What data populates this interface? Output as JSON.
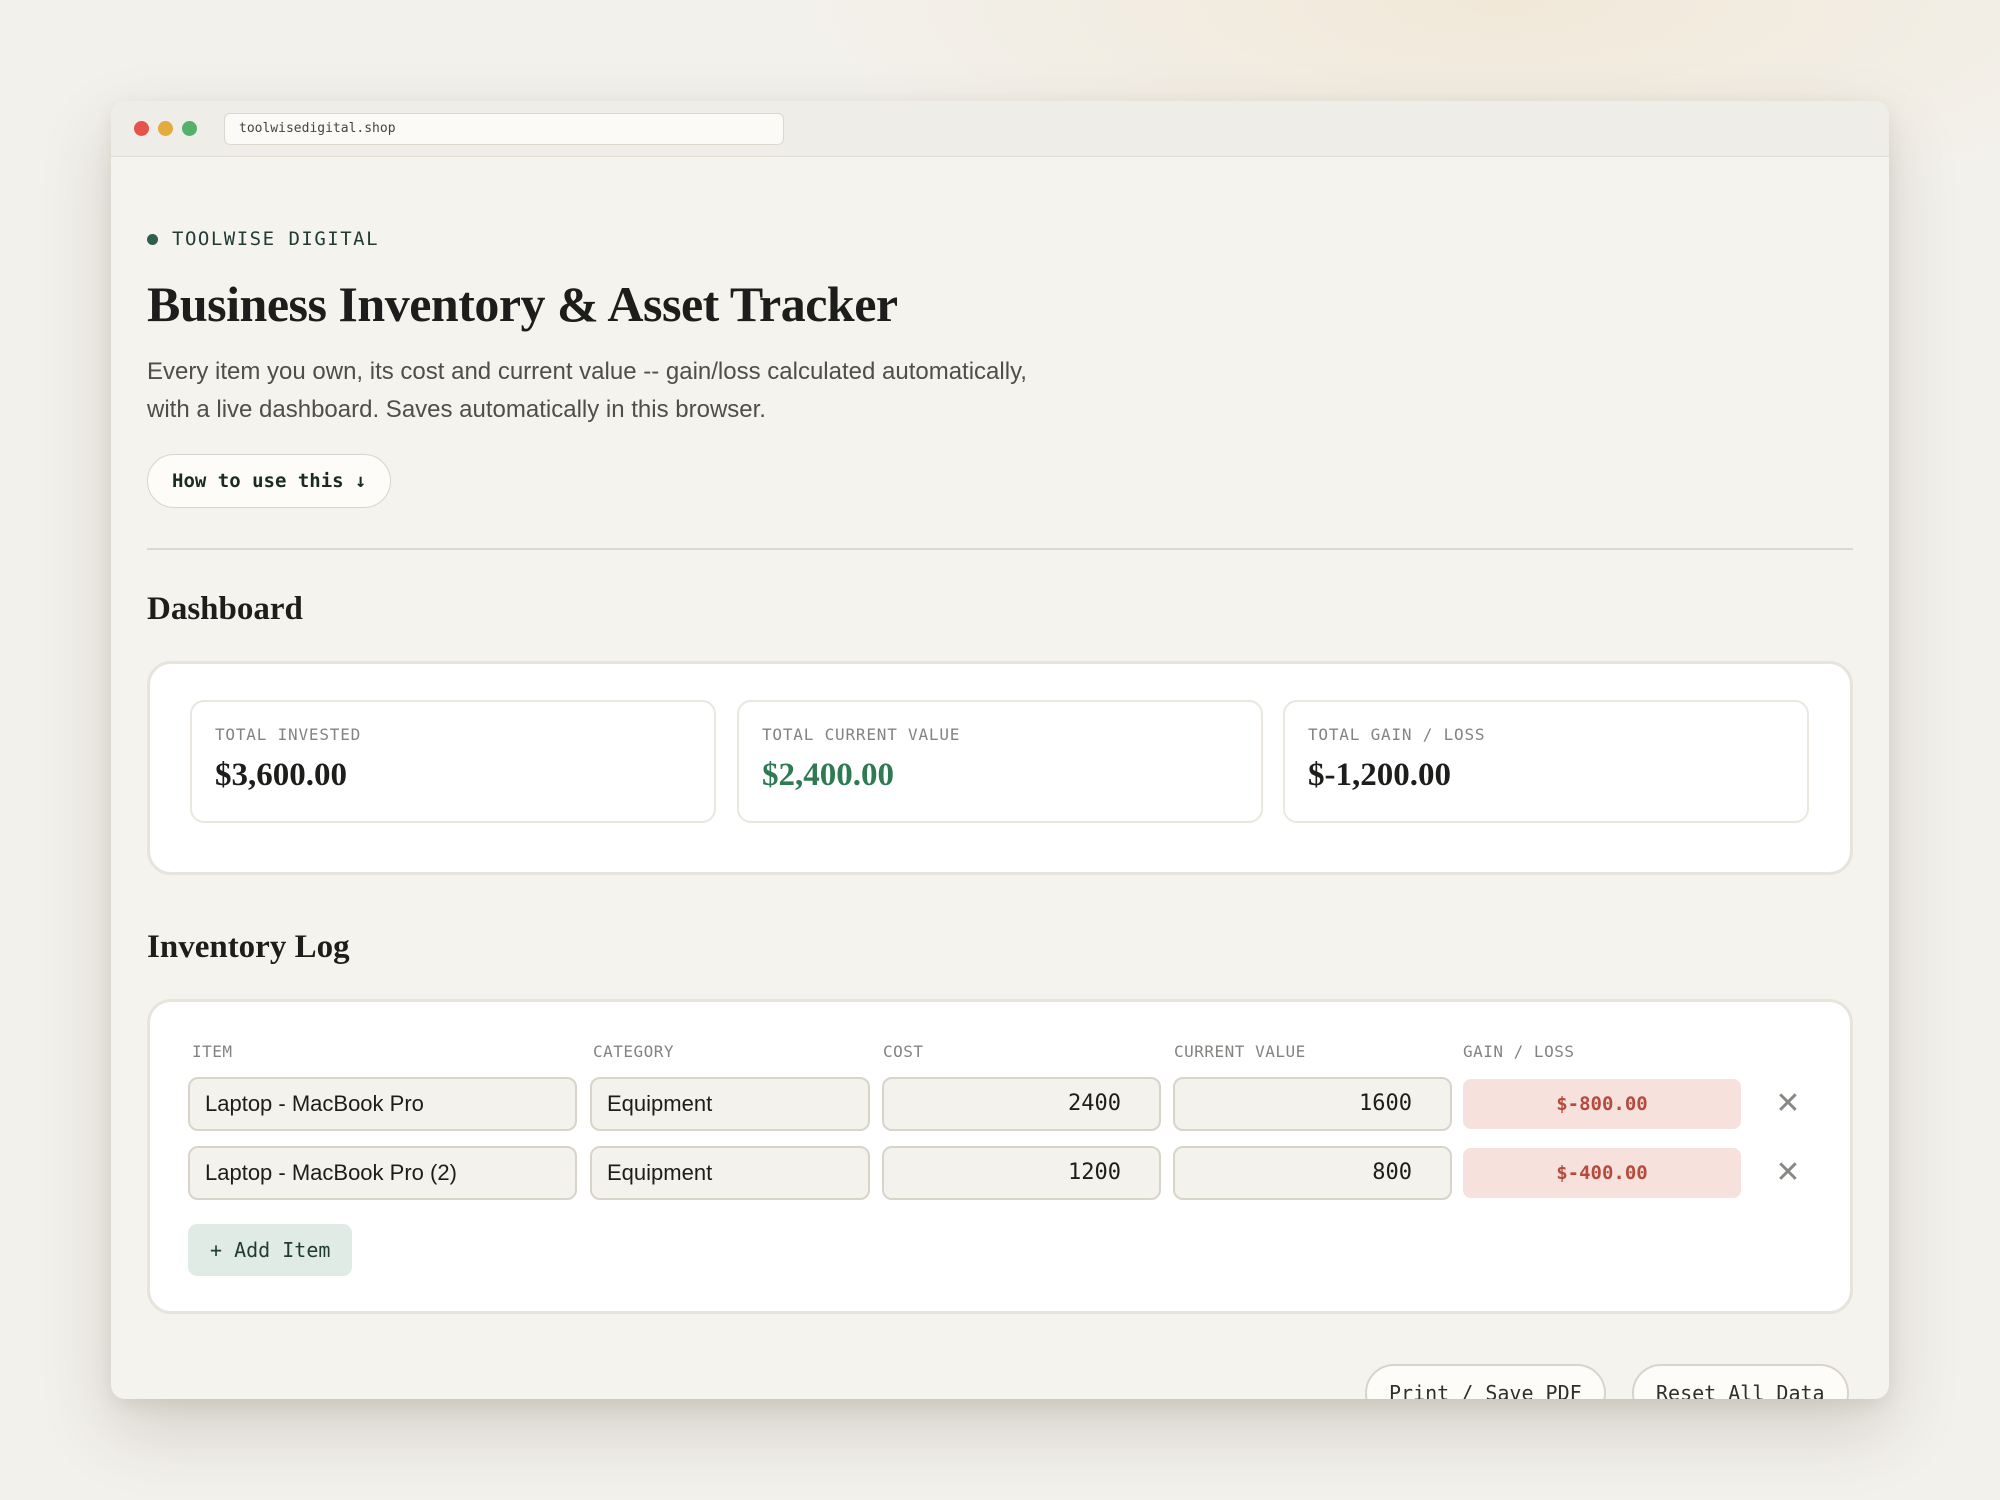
{
  "browser": {
    "url": "toolwisedigital.shop"
  },
  "header": {
    "brand": "TOOLWISE DIGITAL",
    "title": "Business Inventory & Asset Tracker",
    "subtitle": "Every item you own, its cost and current value -- gain/loss calculated automatically, with a live dashboard. Saves automatically in this browser.",
    "howto_label": "How to use this ↓"
  },
  "dashboard": {
    "title": "Dashboard",
    "stats": [
      {
        "label": "TOTAL INVESTED",
        "value": "$3,600.00"
      },
      {
        "label": "TOTAL CURRENT VALUE",
        "value": "$2,400.00"
      },
      {
        "label": "TOTAL GAIN / LOSS",
        "value": "$-1,200.00"
      }
    ]
  },
  "inventory": {
    "title": "Inventory Log",
    "columns": [
      "ITEM",
      "CATEGORY",
      "COST",
      "CURRENT VALUE",
      "GAIN / LOSS"
    ],
    "rows": [
      {
        "item": "Laptop - MacBook Pro",
        "category": "Equipment",
        "cost": "2400",
        "current_value": "1600",
        "gain_loss": "$-800.00"
      },
      {
        "item": "Laptop - MacBook Pro (2)",
        "category": "Equipment",
        "cost": "1200",
        "current_value": "800",
        "gain_loss": "$-400.00"
      }
    ],
    "delete_glyph": "✕",
    "add_label": "+ Add Item"
  },
  "footer": {
    "print_label": "Print / Save PDF",
    "reset_label": "Reset All Data"
  },
  "colors": {
    "accent": "#2d5e4f",
    "positive": "#2f7a53",
    "negative": "#b64a3c",
    "negative_bg": "#f6e1dc"
  }
}
